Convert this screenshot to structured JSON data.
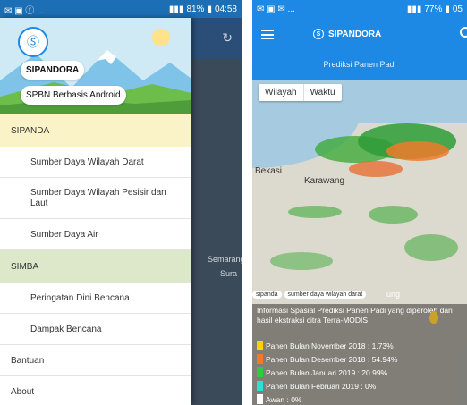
{
  "left": {
    "status": {
      "left": "✉ ▣ ⓕ ...",
      "battery": "81%",
      "time": "04:58"
    },
    "map_labels": {
      "semarang": "Semarang",
      "sura": "Sura"
    },
    "reload_icon": "↻",
    "drawer": {
      "logo": "Ⓢ",
      "title": "SIPANDORA",
      "subtitle": "SPBN Berbasis Android",
      "sections": [
        {
          "label": "SIPANDA",
          "items": [
            "Sumber Daya Wilayah Darat",
            "Sumber Daya Wilayah Pesisir dan Laut",
            "Sumber Daya Air"
          ]
        },
        {
          "label": "SIMBA",
          "items": [
            "Peringatan Dini Bencana",
            "Dampak Bencana"
          ]
        }
      ],
      "bantuan": "Bantuan",
      "about": "About"
    },
    "colors": {
      "sipanda_bg": "#fbf3c8",
      "simba_bg": "#dde8cb"
    }
  },
  "right": {
    "status": {
      "left": "✉ ▣ ✉ ...",
      "battery": "77%",
      "time": "05"
    },
    "app_title": "SIPANDORA",
    "page_title": "Prediksi Panen Padi",
    "segments": [
      "Wilayah",
      "Waktu"
    ],
    "places": {
      "bekasi": "Bekasi",
      "karawang": "Karawang",
      "tail": "ung"
    },
    "tags": [
      "sipanda",
      "sumber daya wilayah darat"
    ],
    "info": "Informasi Spasial Prediksi Panen Padi yang diperoleh dari hasil ekstraksi citra Terra-MODIS",
    "legend": [
      {
        "label": "Panen Bulan November 2018  : 1.73%",
        "color": "#ffd400"
      },
      {
        "label": "Panen Bulan Desember 2018  : 54.94%",
        "color": "#f07a2a"
      },
      {
        "label": "Panen Bulan Januari 2019  : 20.99%",
        "color": "#2ecc40"
      },
      {
        "label": "Panen Bulan Februari 2019  : 0%",
        "color": "#2be0d8"
      },
      {
        "label": "Awan : 0%",
        "color": "#ffffff"
      }
    ]
  }
}
